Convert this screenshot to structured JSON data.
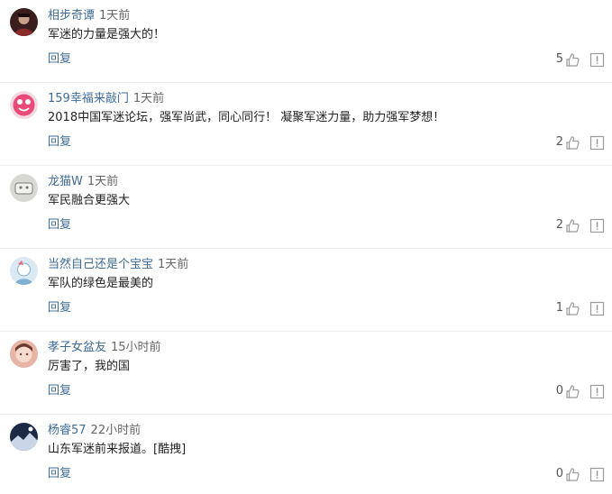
{
  "comments": [
    {
      "user": "相步奇谭",
      "time": "1天前",
      "text": "军迷的力量是强大的！",
      "reply_label": "回复",
      "likes": "5",
      "avatar": {
        "icon": "avatar-icon",
        "bg": "#3a1e1e",
        "accent": "#c7a08a"
      }
    },
    {
      "user": "159幸福来敲门",
      "time": "1天前",
      "text": "2018中国军迷论坛，强军尚武，同心同行！ 凝聚军迷力量，助力强军梦想！",
      "reply_label": "回复",
      "likes": "2",
      "avatar": {
        "icon": "avatar-icon",
        "bg": "#e94b78",
        "accent": "#ffffff"
      }
    },
    {
      "user": "龙猫W",
      "time": "1天前",
      "text": "军民融合更强大",
      "reply_label": "回复",
      "likes": "2",
      "avatar": {
        "icon": "avatar-icon",
        "bg": "#d8d8d4",
        "accent": "#7b7b75"
      }
    },
    {
      "user": "当然自己还是个宝宝",
      "time": "1天前",
      "text": "军队的绿色是最美的",
      "reply_label": "回复",
      "likes": "1",
      "avatar": {
        "icon": "avatar-icon",
        "bg": "#dbe9f2",
        "accent": "#7fb0d2"
      }
    },
    {
      "user": "孝子女盆友",
      "time": "15小时前",
      "text": "厉害了，我的国",
      "reply_label": "回复",
      "likes": "0",
      "avatar": {
        "icon": "avatar-icon",
        "bg": "#e8b4a6",
        "accent": "#6b3b2f"
      }
    },
    {
      "user": "杨睿57",
      "time": "22小时前",
      "text": "山东军迷前来报道。[酷拽]",
      "reply_label": "回复",
      "likes": "0",
      "avatar": {
        "icon": "avatar-icon",
        "bg": "#1c2a44",
        "accent": "#c9d6e8"
      }
    }
  ],
  "colors": {
    "username": "#3f6b94",
    "reply": "#3f6b94",
    "icon_stroke": "#9a9a9a"
  }
}
